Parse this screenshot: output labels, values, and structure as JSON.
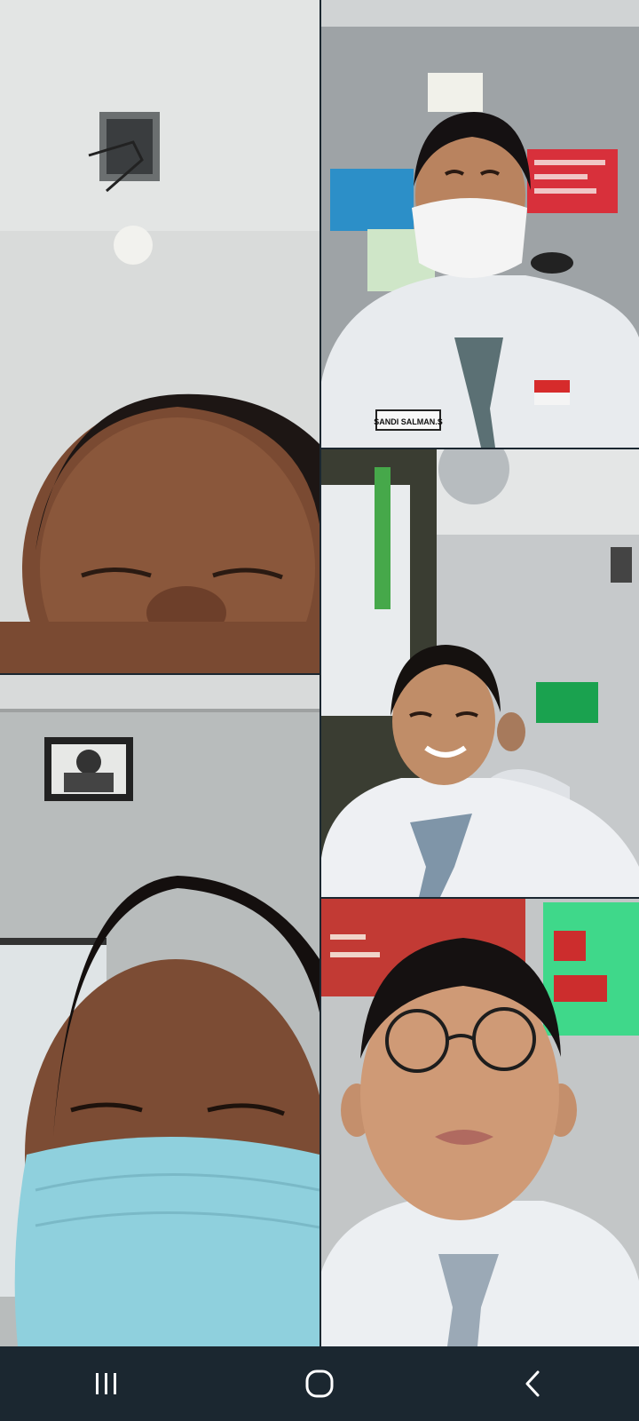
{
  "video_call": {
    "participants": [
      {
        "id": "p1",
        "name_tag": ""
      },
      {
        "id": "p2",
        "name_tag": "SANDI SALMAN.S"
      },
      {
        "id": "p3",
        "name_tag": ""
      },
      {
        "id": "p4",
        "name_tag": ""
      },
      {
        "id": "p5",
        "name_tag": ""
      }
    ]
  },
  "system_nav": {
    "buttons": [
      "recent-apps",
      "home",
      "back"
    ]
  },
  "colors": {
    "nav_bar_bg": "#1b2730",
    "nav_icon": "#ffffff"
  }
}
